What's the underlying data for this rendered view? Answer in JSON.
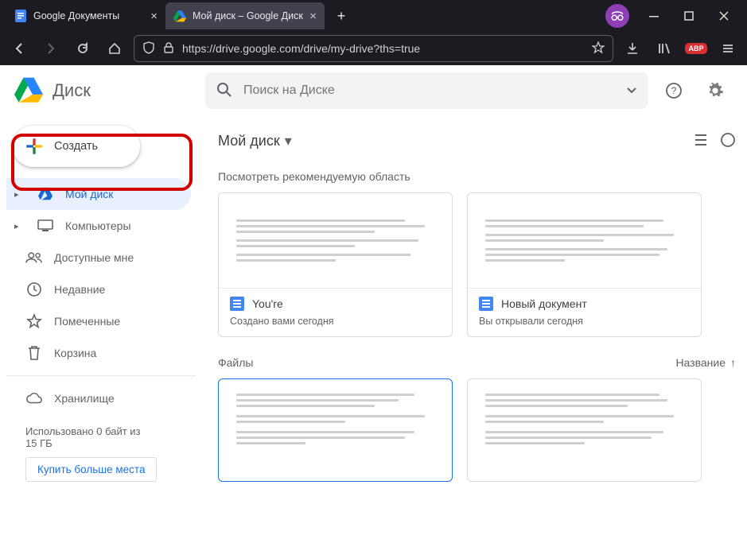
{
  "browser": {
    "tabs": [
      {
        "title": "Google Документы"
      },
      {
        "title": "Мой диск – Google Диск"
      }
    ],
    "url": "https://drive.google.com/drive/my-drive?ths=true"
  },
  "app": {
    "product_name": "Диск",
    "search_placeholder": "Поиск на Диске",
    "create_label": "Создать",
    "nav": {
      "my_drive": "Мой диск",
      "computers": "Компьютеры",
      "shared": "Доступные мне",
      "recent": "Недавние",
      "starred": "Помеченные",
      "trash": "Корзина",
      "storage": "Хранилище"
    },
    "storage_text_1": "Использовано 0 байт из",
    "storage_text_2": "15 ГБ",
    "buy_more": "Купить больше места",
    "breadcrumb": "Мой диск",
    "suggested_title": "Посмотреть рекомендуемую область",
    "suggested": [
      {
        "title": "You're",
        "sub": "Создано вами сегодня"
      },
      {
        "title": "Новый документ",
        "sub": "Вы открывали сегодня"
      }
    ],
    "files_label": "Файлы",
    "sort_label": "Название"
  }
}
